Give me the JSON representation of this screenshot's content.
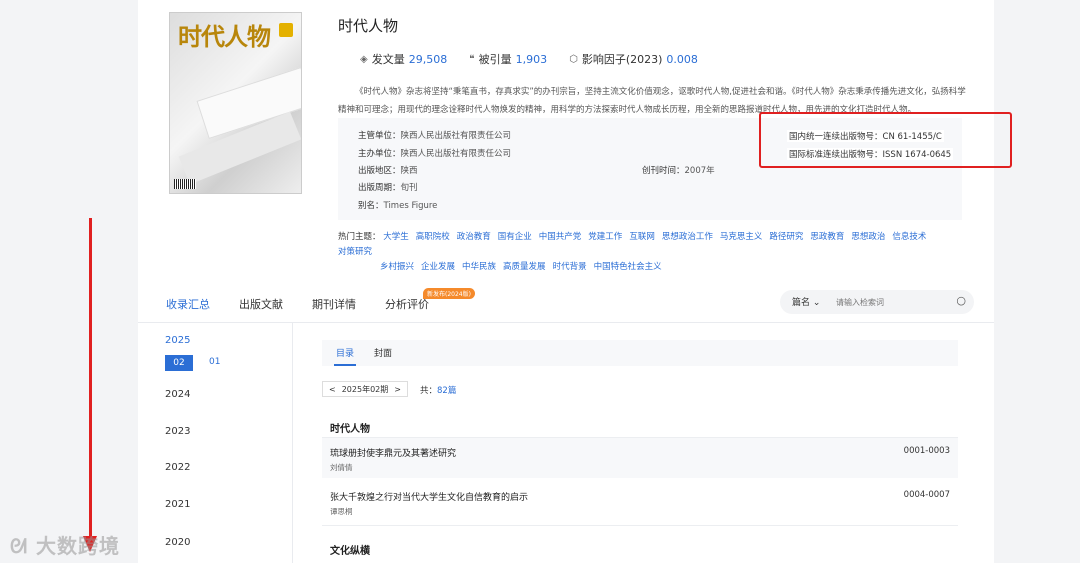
{
  "journal": {
    "cover_title": "时代人物",
    "title": "时代人物",
    "stats": [
      {
        "icon": "document-stack-icon",
        "label": "发文量",
        "value": "29,508"
      },
      {
        "icon": "quote-icon",
        "label": "被引量",
        "value": "1,903"
      },
      {
        "icon": "cube-icon",
        "label": "影响因子(2023)",
        "value": "0.008"
      }
    ],
    "description": "《时代人物》杂志将坚持“秉笔直书，存真求实”的办刊宗旨，坚持主流文化价值观念，讴歌时代人物,促进社会和谐。《时代人物》杂志秉承传播先进文化，弘扬科学精神和可理念；用现代的理念诠释时代人物焕发的精神，用科学的方法探索时代人物成长历程，用全新的思路报道时代人物，用先进的文化打造时代人物。",
    "info": {
      "supervisor": {
        "k": "主管单位：",
        "v": "陕西人民出版社有限责任公司"
      },
      "sponsor": {
        "k": "主办单位：",
        "v": "陕西人民出版社有限责任公司"
      },
      "region": {
        "k": "出版地区：",
        "v": "陕西"
      },
      "period": {
        "k": "出版周期：",
        "v": "旬刊"
      },
      "alias": {
        "k": "别名：",
        "v": "Times Figure"
      },
      "cn": {
        "k": "国内统一连续出版物号：",
        "v": "CN 61-1455/C"
      },
      "issn": {
        "k": "国际标准连续出版物号：",
        "v": "ISSN 1674-0645"
      },
      "founded": {
        "k": "创刊时间：",
        "v": "2007年"
      }
    },
    "topics_label": "热门主题：",
    "topics": [
      "大学生",
      "高职院校",
      "政治教育",
      "国有企业",
      "中国共产党",
      "党建工作",
      "互联网",
      "思想政治工作",
      "马克思主义",
      "路径研究",
      "思政教育",
      "思想政治",
      "信息技术",
      "对策研究",
      "乡村振兴",
      "企业发展",
      "中华民族",
      "高质量发展",
      "时代背景",
      "中国特色社会主义"
    ]
  },
  "tabs": [
    {
      "label": "收录汇总",
      "active": true
    },
    {
      "label": "出版文献",
      "active": false
    },
    {
      "label": "期刊详情",
      "active": false
    },
    {
      "label": "分析评价",
      "active": false
    }
  ],
  "new_badge": "新发布(2024版)",
  "search": {
    "type": "篇名",
    "placeholder": "请输入检索词"
  },
  "years": [
    "2025",
    "2024",
    "2023",
    "2022",
    "2021",
    "2020"
  ],
  "issues": {
    "active": "02",
    "other": "01"
  },
  "subtabs": [
    {
      "label": "目录",
      "active": true
    },
    {
      "label": "封面",
      "active": false
    }
  ],
  "pager": {
    "label": "2025年02期",
    "prev": "<",
    "next": ">"
  },
  "count": {
    "prefix": "共：",
    "value": "82篇"
  },
  "sections": [
    {
      "name": "时代人物",
      "articles": [
        {
          "title": "琉球册封使李鼎元及其著述研究",
          "author": "刘倩倩",
          "pages": "0001-0003"
        },
        {
          "title": "张大千敦煌之行对当代大学生文化自信教育的启示",
          "author": "谭思桐",
          "pages": "0004-0007"
        }
      ]
    },
    {
      "name": "文化纵横",
      "articles": []
    }
  ],
  "watermark": "大数跨境",
  "colors": {
    "accent": "#2b6ed5",
    "annotation": "#e02020",
    "badge": "#f58a2b"
  }
}
